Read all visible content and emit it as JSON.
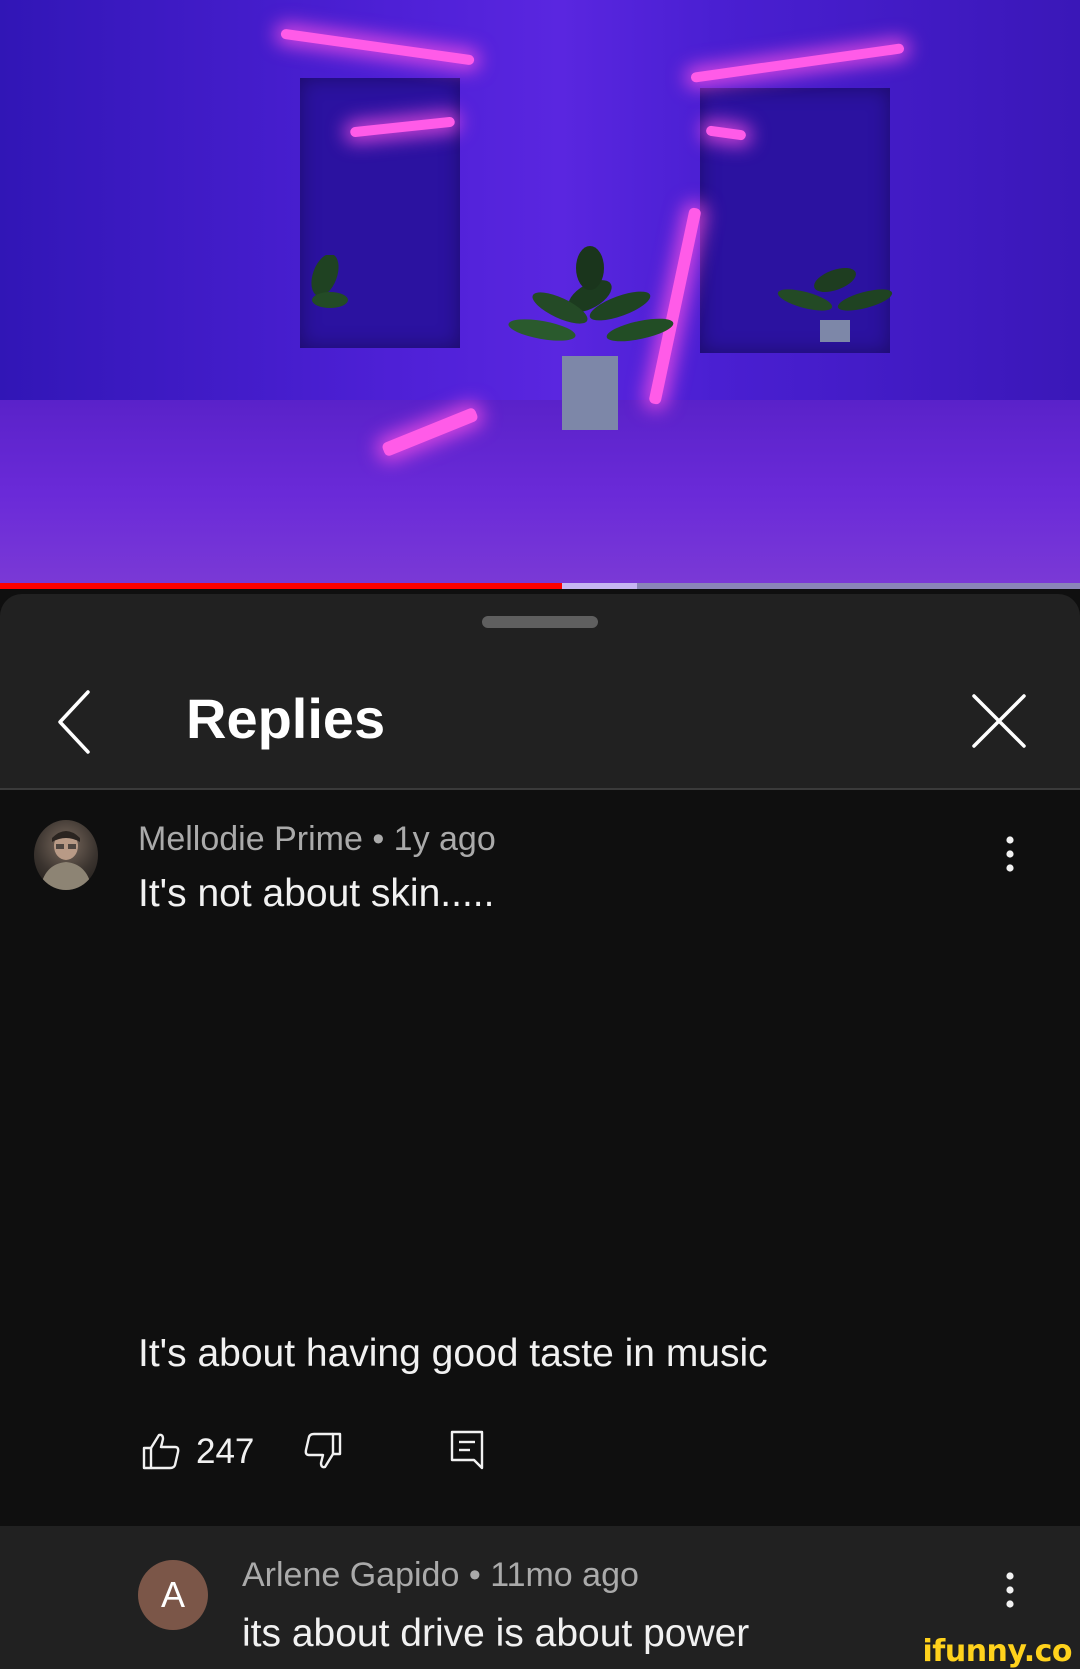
{
  "video": {
    "progress_percent": 52,
    "buffer_percent": 59,
    "colors": {
      "played": "#ff0000",
      "buffered": "#c7b6f2",
      "track": "#8a86b8"
    }
  },
  "header": {
    "title": "Replies",
    "back_icon": "chevron-left-icon",
    "close_icon": "close-icon"
  },
  "comments": [
    {
      "author": "Mellodie Prime",
      "separator": "•",
      "time": "1y ago",
      "text_line_1": "It's not about skin.....",
      "text_line_2": "It's about having good taste in music",
      "likes": "247",
      "icons": [
        "thumbs-up-icon",
        "thumbs-down-icon",
        "reply-icon",
        "more-vert-icon"
      ]
    },
    {
      "author": "Arlene Gapido",
      "separator": "•",
      "time": "11mo ago",
      "avatar_letter": "A",
      "text_line_1": "its about drive is about power"
    }
  ],
  "watermark": "ifunny.co"
}
